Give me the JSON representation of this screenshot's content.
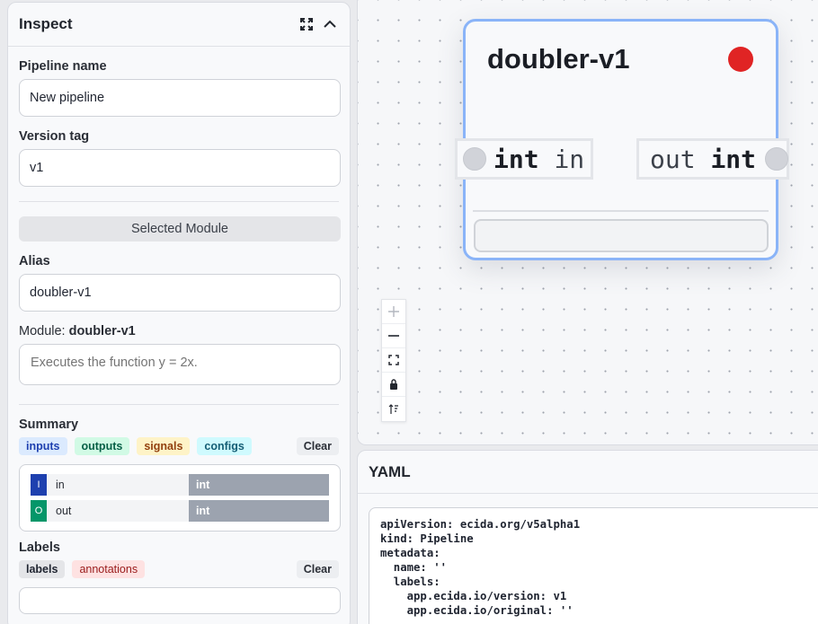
{
  "inspect": {
    "title": "Inspect",
    "pipeline_name": {
      "label": "Pipeline name",
      "value": "New pipeline"
    },
    "version_tag": {
      "label": "Version tag",
      "value": "v1"
    },
    "selected_module_label": "Selected Module",
    "alias": {
      "label": "Alias",
      "value": "doubler-v1"
    },
    "module": {
      "label": "Module:",
      "name": "doubler-v1",
      "description_placeholder": "Executes the function y = 2x."
    },
    "summary": {
      "label": "Summary",
      "tags": [
        "inputs",
        "outputs",
        "signals",
        "configs"
      ],
      "clear_label": "Clear",
      "rows": [
        {
          "badge": "I",
          "name": "in",
          "type": "int"
        },
        {
          "badge": "O",
          "name": "out",
          "type": "int"
        }
      ]
    },
    "labels": {
      "label": "Labels",
      "tags": [
        "labels",
        "annotations"
      ],
      "clear_label": "Clear"
    }
  },
  "node": {
    "title": "doubler-v1",
    "status_color": "#e02424",
    "input_port": {
      "type": "int",
      "name": "in"
    },
    "output_port": {
      "name": "out",
      "type": "int"
    }
  },
  "controls": [
    "zoom-in",
    "zoom-out",
    "fit-view",
    "lock",
    "sort"
  ],
  "yaml": {
    "title": "YAML",
    "lines": [
      "apiVersion: ecida.org/v5alpha1",
      "kind: Pipeline",
      "metadata:",
      "  name: ''",
      "  labels:",
      "    app.ecida.io/version: v1",
      "    app.ecida.io/original: ''"
    ]
  },
  "colors": {
    "accent_blue": "#8ab4f8",
    "status_red": "#e02424"
  }
}
